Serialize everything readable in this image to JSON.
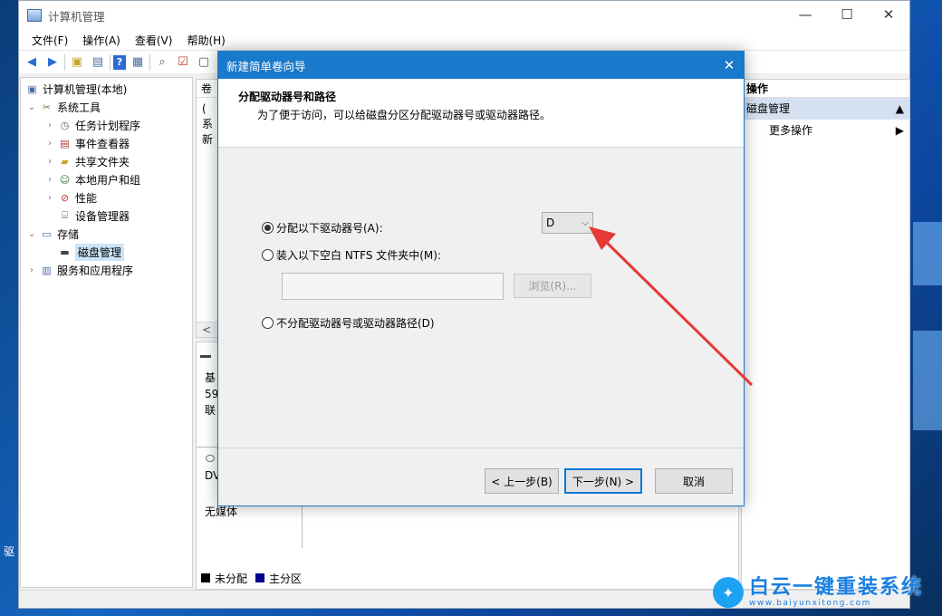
{
  "window": {
    "title": "计算机管理",
    "controls": {
      "minimize": "—",
      "maximize": "☐",
      "close": "✕"
    }
  },
  "menu": [
    "文件(F)",
    "操作(A)",
    "查看(V)",
    "帮助(H)"
  ],
  "tree": {
    "root": "计算机管理(本地)",
    "system_tools": "系统工具",
    "task_scheduler": "任务计划程序",
    "event_viewer": "事件查看器",
    "shared_folders": "共享文件夹",
    "local_users": "本地用户和组",
    "performance": "性能",
    "device_manager": "设备管理器",
    "storage": "存储",
    "disk_management": "磁盘管理",
    "services_apps": "服务和应用程序"
  },
  "center": {
    "column_header": "卷",
    "row_glyphs": [
      "(",
      "系",
      "新"
    ],
    "scroll_left": "<",
    "disk0_type": "基",
    "disk0_size": "59",
    "disk0_status": "联",
    "dvd_label": "DV",
    "dvd_status": "无媒体"
  },
  "legend": {
    "unallocated": "未分配",
    "primary": "主分区",
    "unallocated_color": "#000000",
    "primary_color": "#00008b"
  },
  "actions": {
    "header": "操作",
    "section": "磁盘管理",
    "more": "更多操作"
  },
  "dialog": {
    "title": "新建简单卷向导",
    "header_title": "分配驱动器号和路径",
    "header_subtitle": "为了便于访问，可以给磁盘分区分配驱动器号或驱动器路径。",
    "option_assign": "分配以下驱动器号(A):",
    "drive_letter": "D",
    "option_mount": "装入以下空白 NTFS 文件夹中(M):",
    "mount_path": "",
    "browse": "浏览(R)...",
    "option_none": "不分配驱动器号或驱动器路径(D)",
    "back": "< 上一步(B)",
    "next": "下一步(N) >",
    "cancel": "取消"
  },
  "watermark": {
    "text": "白云一键重装系统",
    "url": "www.baiyunxitong.com"
  },
  "desktop": {
    "left_label": "驱"
  }
}
